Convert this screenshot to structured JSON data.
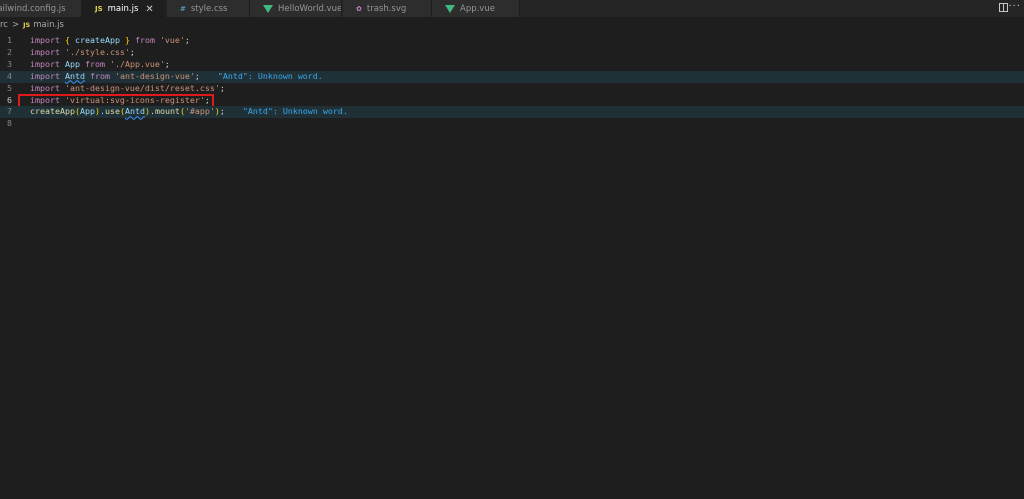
{
  "tabs": [
    {
      "label": "tailwind.config.js",
      "icon": "js-file-icon",
      "active": false
    },
    {
      "label": "main.js",
      "icon": "js-file-icon",
      "active": true
    },
    {
      "label": "style.css",
      "icon": "css-file-icon",
      "active": false
    },
    {
      "label": "HelloWorld.vue",
      "icon": "vue-file-icon",
      "active": false
    },
    {
      "label": "trash.svg",
      "icon": "svg-file-icon",
      "active": false
    },
    {
      "label": "App.vue",
      "icon": "vue-file-icon",
      "active": false
    }
  ],
  "icon_glyphs": {
    "js": "JS",
    "css": "#",
    "svg": "✿"
  },
  "close_glyph": "✕",
  "breadcrumb": {
    "folder": "rc",
    "separator": ">",
    "file": "main.js"
  },
  "lines": [
    {
      "num": "1",
      "parts": [
        [
          "kw",
          "import"
        ],
        [
          "pn",
          " "
        ],
        [
          "br",
          "{"
        ],
        [
          "pn",
          " "
        ],
        [
          "id",
          "createApp"
        ],
        [
          "pn",
          " "
        ],
        [
          "br",
          "}"
        ],
        [
          "pn",
          " "
        ],
        [
          "kw",
          "from"
        ],
        [
          "pn",
          " "
        ],
        [
          "str",
          "'vue'"
        ],
        [
          "pn",
          ";"
        ]
      ]
    },
    {
      "num": "2",
      "parts": [
        [
          "kw",
          "import"
        ],
        [
          "pn",
          " "
        ],
        [
          "str",
          "'./style.css'"
        ],
        [
          "pn",
          ";"
        ]
      ]
    },
    {
      "num": "3",
      "parts": [
        [
          "kw",
          "import"
        ],
        [
          "pn",
          " "
        ],
        [
          "id",
          "App"
        ],
        [
          "pn",
          " "
        ],
        [
          "kw",
          "from"
        ],
        [
          "pn",
          " "
        ],
        [
          "str",
          "'./App.vue'"
        ],
        [
          "pn",
          ";"
        ]
      ]
    },
    {
      "num": "4",
      "parts": [
        [
          "kw",
          "import"
        ],
        [
          "pn",
          " "
        ],
        [
          "id",
          "Antd"
        ],
        [
          "pn",
          " "
        ],
        [
          "kw",
          "from"
        ],
        [
          "pn",
          " "
        ],
        [
          "str",
          "'ant-design-vue'"
        ],
        [
          "pn",
          ";"
        ]
      ],
      "diag": "\"Antd\": Unknown word.",
      "squiggle": "Antd"
    },
    {
      "num": "5",
      "parts": [
        [
          "kw",
          "import"
        ],
        [
          "pn",
          " "
        ],
        [
          "str",
          "'ant-design-vue/dist/reset.css'"
        ],
        [
          "pn",
          ";"
        ]
      ]
    },
    {
      "num": "6",
      "parts": [
        [
          "kw",
          "import"
        ],
        [
          "pn",
          " "
        ],
        [
          "str",
          "'virtual:svg-icons-register'"
        ],
        [
          "pn",
          ";"
        ]
      ],
      "current": true
    },
    {
      "num": "7",
      "parts": [
        [
          "fn",
          "createApp"
        ],
        [
          "br",
          "("
        ],
        [
          "id",
          "App"
        ],
        [
          "br",
          ")"
        ],
        [
          "pn",
          "."
        ],
        [
          "fn",
          "use"
        ],
        [
          "br",
          "("
        ],
        [
          "id",
          "Antd"
        ],
        [
          "br",
          ")"
        ],
        [
          "pn",
          "."
        ],
        [
          "fn",
          "mount"
        ],
        [
          "br",
          "("
        ],
        [
          "str",
          "'#app'"
        ],
        [
          "br",
          ")"
        ],
        [
          "pn",
          ";"
        ]
      ],
      "diag": "\"Antd\": Unknown word.",
      "squiggle": "Antd"
    },
    {
      "num": "8",
      "parts": []
    }
  ]
}
